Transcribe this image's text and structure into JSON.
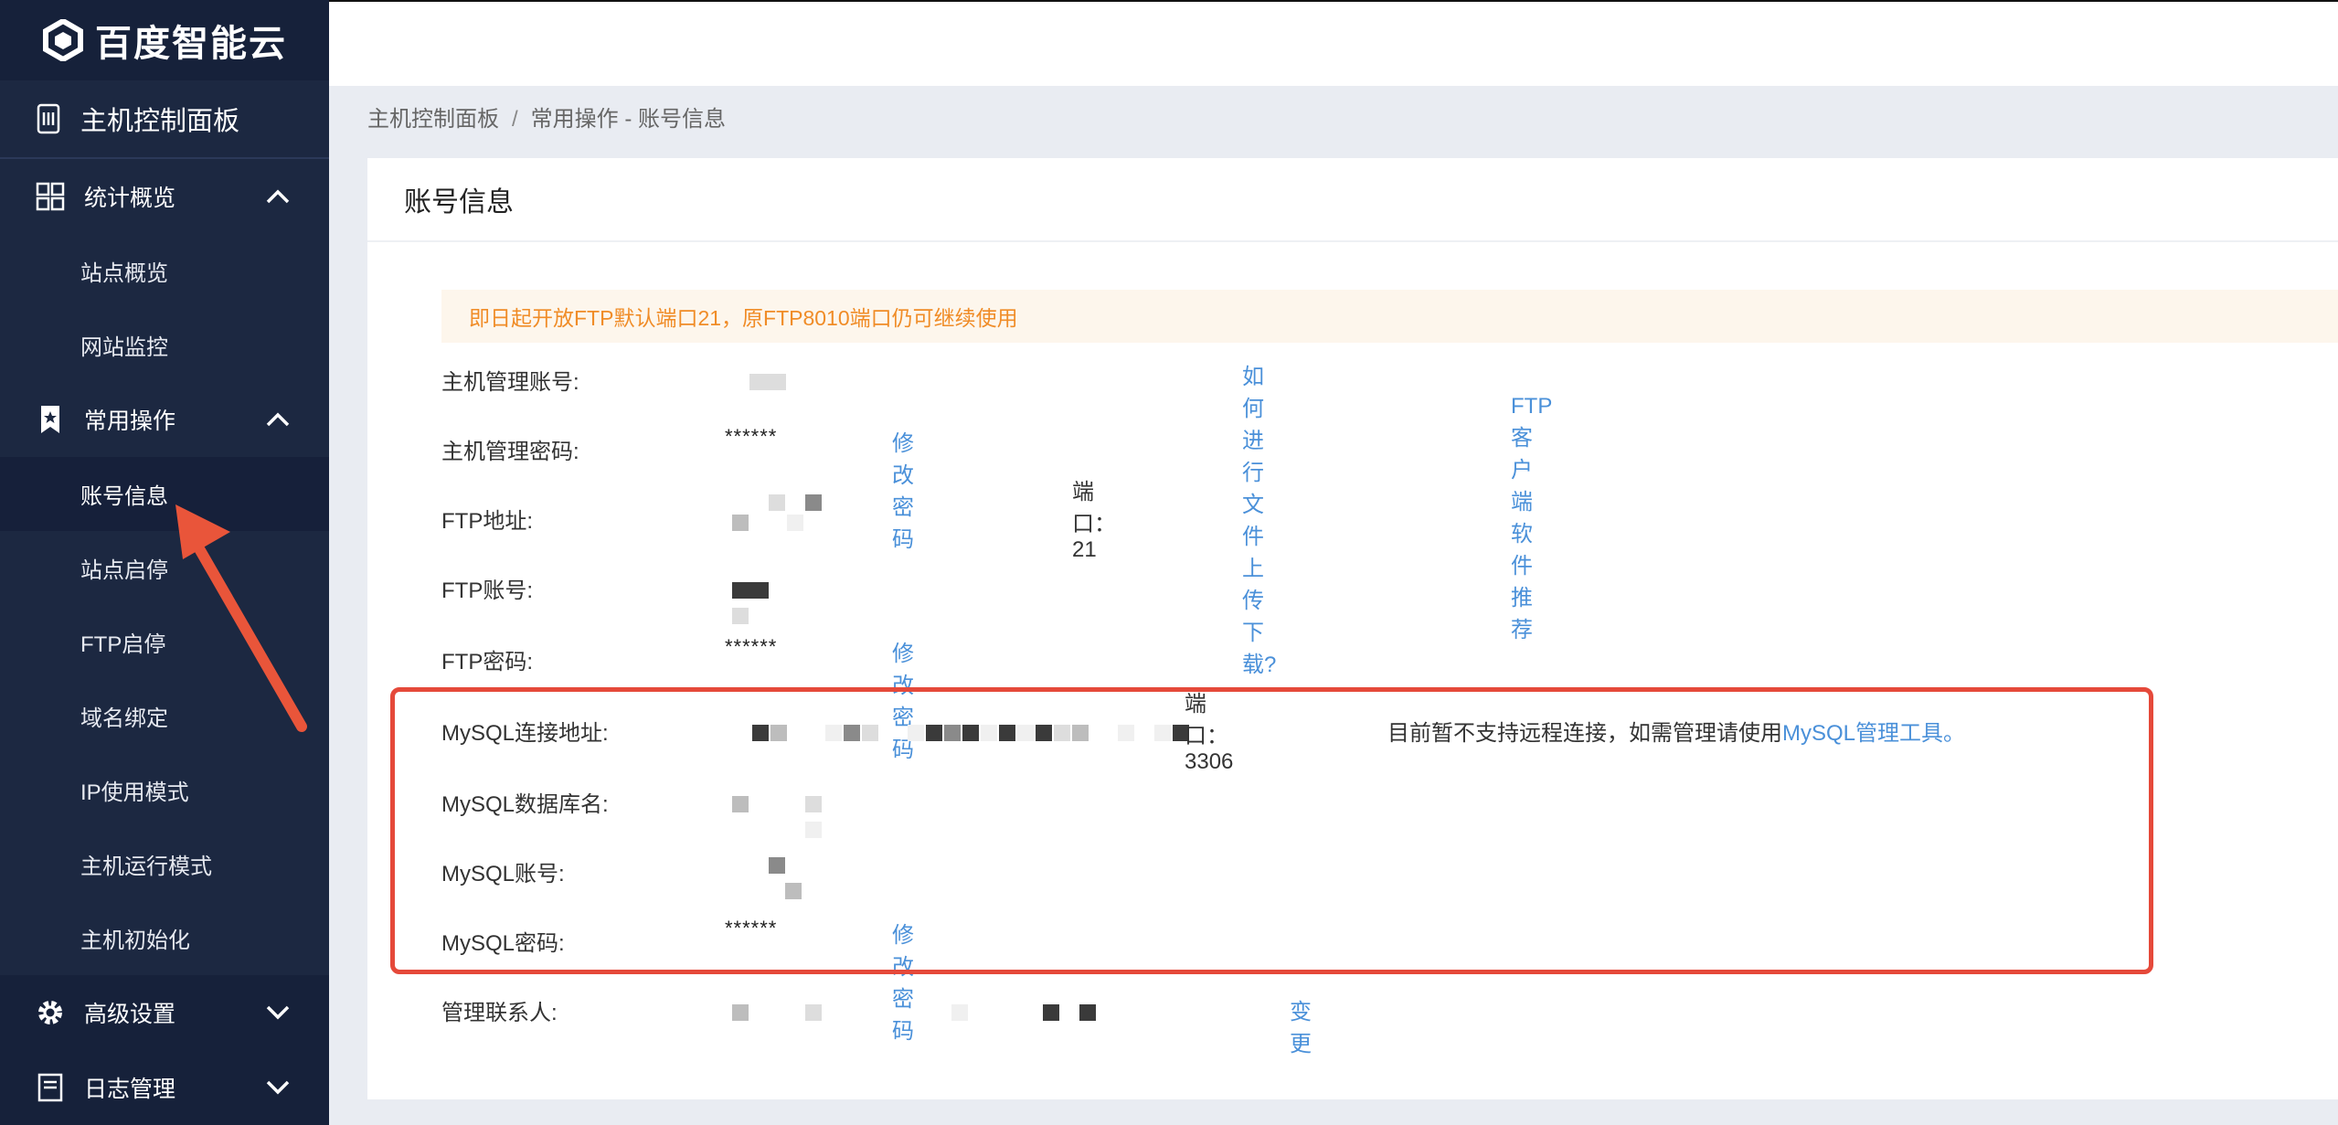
{
  "brand": {
    "name": "百度智能云"
  },
  "sidebar": {
    "panel_title": "主机控制面板",
    "groups": [
      {
        "label": "统计概览",
        "items": [
          "站点概览",
          "网站监控"
        ]
      },
      {
        "label": "常用操作",
        "items": [
          "账号信息",
          "站点启停",
          "FTP启停",
          "域名绑定",
          "IP使用模式",
          "主机运行模式",
          "主机初始化"
        ]
      },
      {
        "label": "高级设置"
      },
      {
        "label": "日志管理"
      }
    ],
    "active_item": "账号信息"
  },
  "breadcrumb": {
    "root": "主机控制面板",
    "sep": "/",
    "current": "常用操作 - 账号信息"
  },
  "card": {
    "title": "账号信息",
    "notice": "即日起开放FTP默认端口21，原FTP8010端口仍可继续使用",
    "rows": {
      "host_account": {
        "label": "主机管理账号:"
      },
      "host_password": {
        "label": "主机管理密码:",
        "value": "******",
        "link": "修改密码"
      },
      "ftp_address": {
        "label": "FTP地址:",
        "port": "端口：21",
        "link1": "如何进行文件上传下载?",
        "link2": "FTP客户端软件推荐"
      },
      "ftp_account": {
        "label": "FTP账号:"
      },
      "ftp_password": {
        "label": "FTP密码:",
        "value": "******",
        "link": "修改密码"
      },
      "mysql_address": {
        "label": "MySQL连接地址:",
        "port": "端口：3306",
        "note": "目前暂不支持远程连接，如需管理请使用",
        "link": "MySQL管理工具。"
      },
      "mysql_db": {
        "label": "MySQL数据库名:"
      },
      "mysql_account": {
        "label": "MySQL账号:"
      },
      "mysql_password": {
        "label": "MySQL密码:",
        "value": "******",
        "link": "修改密码"
      },
      "contact": {
        "label": "管理联系人:",
        "link": "变更"
      }
    }
  },
  "colors": {
    "sidebar_bg": "#1c2841",
    "link": "#4a90d9",
    "notice_text": "#f08c27",
    "highlight_border": "#e5493a",
    "arrow": "#e9553a"
  }
}
